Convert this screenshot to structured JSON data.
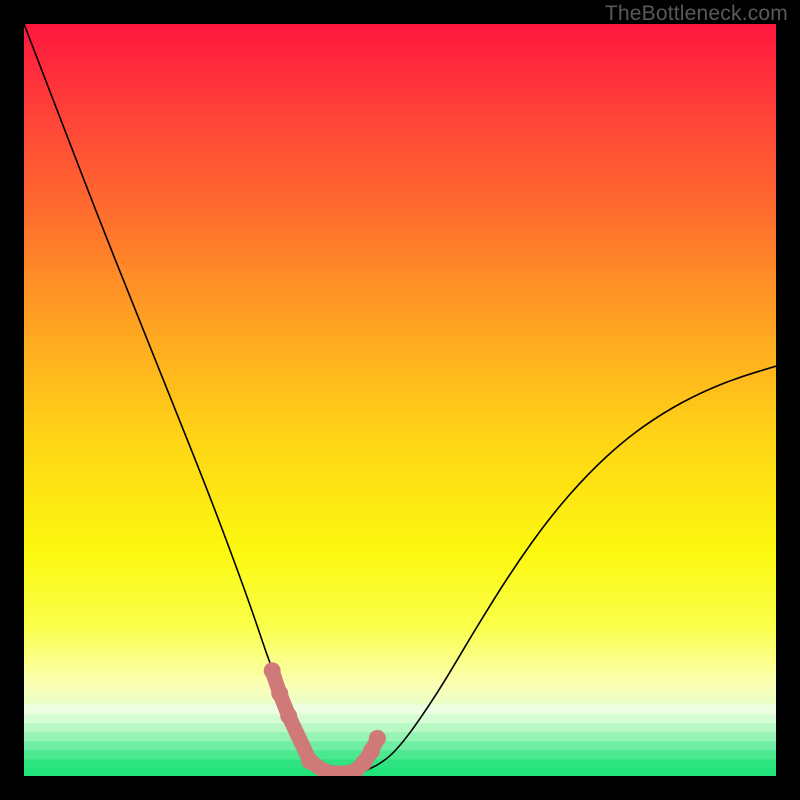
{
  "watermark": "TheBottleneck.com",
  "colors": {
    "frame_bg": "#000000",
    "curve_stroke": "#000000",
    "marker_fill": "#cf7a79",
    "gradient_stops": [
      {
        "offset": 0.0,
        "color": "#ff163e"
      },
      {
        "offset": 0.1,
        "color": "#ff3b3a"
      },
      {
        "offset": 0.25,
        "color": "#ff6d2e"
      },
      {
        "offset": 0.4,
        "color": "#ffa322"
      },
      {
        "offset": 0.55,
        "color": "#ffd416"
      },
      {
        "offset": 0.7,
        "color": "#fcf80f"
      },
      {
        "offset": 0.8,
        "color": "#faff4a"
      },
      {
        "offset": 0.88,
        "color": "#fbffb6"
      },
      {
        "offset": 0.92,
        "color": "#dfffd2"
      },
      {
        "offset": 0.95,
        "color": "#8cf8b4"
      },
      {
        "offset": 0.975,
        "color": "#3ee889"
      },
      {
        "offset": 1.0,
        "color": "#22e37a"
      }
    ],
    "green_bands": [
      {
        "y": 0.905,
        "color": "#ecffe2"
      },
      {
        "y": 0.918,
        "color": "#d6fcd3"
      },
      {
        "y": 0.93,
        "color": "#b8f8c4"
      },
      {
        "y": 0.942,
        "color": "#95f3b5"
      },
      {
        "y": 0.954,
        "color": "#6feda2"
      },
      {
        "y": 0.966,
        "color": "#4be890"
      },
      {
        "y": 0.978,
        "color": "#2ee481"
      },
      {
        "y": 0.99,
        "color": "#22e37a"
      }
    ]
  },
  "chart_data": {
    "type": "line",
    "title": "",
    "xlabel": "",
    "ylabel": "",
    "xlim": [
      0,
      1
    ],
    "ylim": [
      0,
      1
    ],
    "annotations": [],
    "series": [
      {
        "name": "bottleneck-curve",
        "x": [
          0.0,
          0.05,
          0.1,
          0.15,
          0.2,
          0.25,
          0.3,
          0.33,
          0.36,
          0.38,
          0.4,
          0.42,
          0.44,
          0.47,
          0.5,
          0.55,
          0.6,
          0.65,
          0.7,
          0.75,
          0.8,
          0.85,
          0.9,
          0.95,
          1.0
        ],
        "y": [
          1.0,
          0.87,
          0.74,
          0.615,
          0.49,
          0.365,
          0.23,
          0.14,
          0.07,
          0.035,
          0.012,
          0.003,
          0.003,
          0.013,
          0.038,
          0.11,
          0.195,
          0.275,
          0.345,
          0.402,
          0.448,
          0.483,
          0.51,
          0.53,
          0.545
        ]
      }
    ],
    "markers": {
      "name": "highlight-dots",
      "x": [
        0.33,
        0.34,
        0.352,
        0.38,
        0.4,
        0.42,
        0.44,
        0.452,
        0.462,
        0.47
      ],
      "y": [
        0.14,
        0.11,
        0.08,
        0.02,
        0.006,
        0.003,
        0.006,
        0.018,
        0.033,
        0.05
      ]
    }
  }
}
